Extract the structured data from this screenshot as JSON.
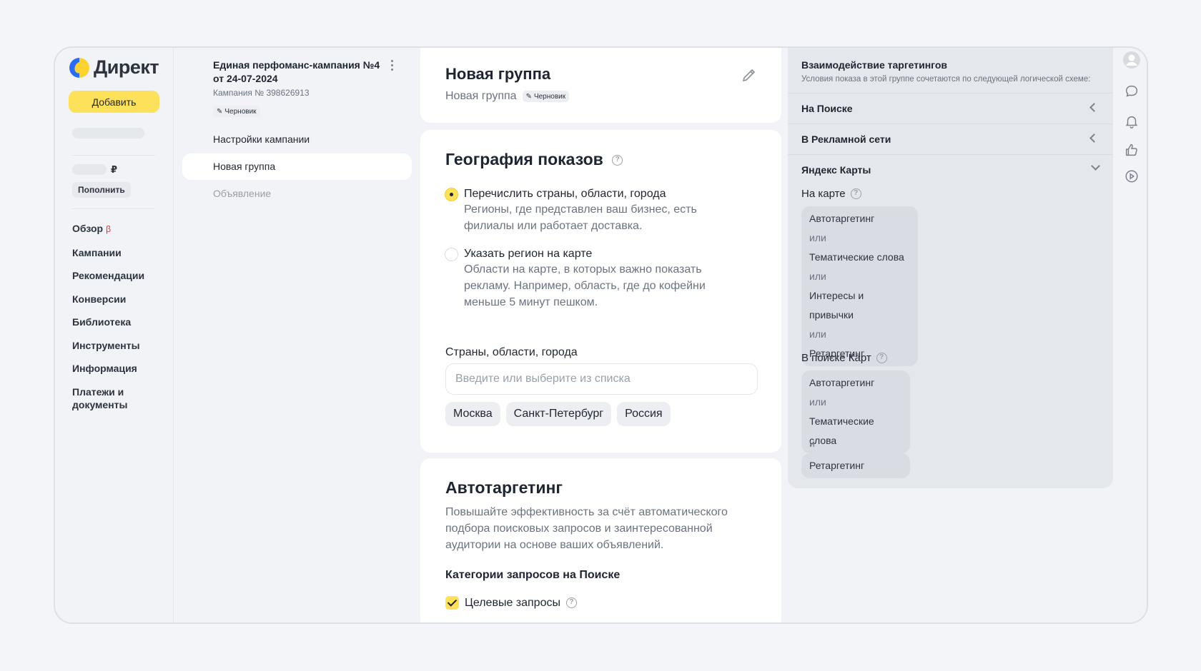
{
  "brand": {
    "name": "Директ"
  },
  "leftnav": {
    "add_label": "Добавить",
    "currency": "₽",
    "topup_label": "Пополнить",
    "items": [
      {
        "label": "Обзор",
        "badge": "β"
      },
      {
        "label": "Кампании"
      },
      {
        "label": "Рекомендации"
      },
      {
        "label": "Конверсии"
      },
      {
        "label": "Библиотека"
      },
      {
        "label": "Инструменты"
      },
      {
        "label": "Информация"
      },
      {
        "label": "Платежи и документы"
      }
    ]
  },
  "campaign": {
    "title": "Единая перфоманс-кампания №4 от 24-07-2024",
    "number": "Кампания № 398626913",
    "status": "Черновик",
    "links": [
      "Настройки кампании",
      "Новая группа",
      "Объявление"
    ]
  },
  "group": {
    "title": "Новая группа",
    "subtitle": "Новая группа",
    "status": "Черновик"
  },
  "geo": {
    "title": "География показов",
    "option1_title": "Перечислить страны, области, города",
    "option1_desc": "Регионы, где представлен ваш бизнес, есть филиалы или работает доставка.",
    "option2_title": "Указать регион на карте",
    "option2_desc": "Области на карте, в которых важно показать рекламу. Например, область, где до кофейни меньше 5 минут пешком.",
    "field_label": "Страны, области, города",
    "placeholder": "Введите или выберите из списка",
    "chips": [
      "Москва",
      "Санкт-Петербург",
      "Россия"
    ]
  },
  "autotargeting": {
    "title": "Автотаргетинг",
    "description": "Повышайте эффективность за счёт автоматического подбора поисковых запросов и заинтересованной аудитории на основе ваших объявлений.",
    "categories_title": "Категории запросов на Поиске",
    "check1": "Целевые запросы"
  },
  "targeting": {
    "title": "Взаимодействие таргетингов",
    "subtitle": "Условия показа в этой группе сочетаются по следующей логической схеме:",
    "sections": [
      "На Поиске",
      "В Рекламной сети",
      "Яндекс Карты"
    ],
    "on_map": {
      "label": "На карте",
      "items": [
        "Автотаргетинг",
        "или",
        "Тематические слова",
        "или",
        "Интересы и привычки",
        "или",
        "Ретаргетинг"
      ]
    },
    "map_search": {
      "label": "В поиске Карт",
      "items": [
        "Автотаргетинг",
        "или",
        "Тематические слова"
      ],
      "and": "и",
      "last": "Ретаргетинг"
    }
  },
  "rail_icons": [
    "avatar-icon",
    "chat-icon",
    "bell-icon",
    "thumbs-up-icon",
    "play-icon"
  ]
}
